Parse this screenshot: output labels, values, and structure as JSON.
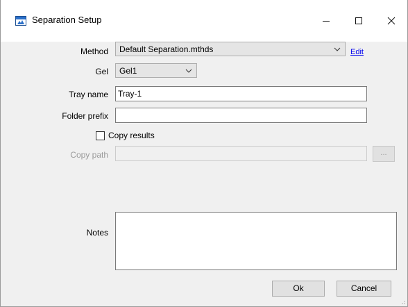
{
  "window": {
    "title": "Separation Setup",
    "icon": "app-icon"
  },
  "titlebar_buttons": {
    "minimize": "—",
    "maximize": "☐",
    "close": "✕"
  },
  "form": {
    "method_label": "Method",
    "method_value": "Default Separation.mthds",
    "edit_link": "Edit",
    "gel_label": "Gel",
    "gel_value": "Gel1",
    "tray_name_label": "Tray name",
    "tray_name_value": "Tray-1",
    "folder_prefix_label": "Folder prefix",
    "folder_prefix_value": "",
    "copy_results_label": "Copy results",
    "copy_results_checked": false,
    "copy_path_label": "Copy path",
    "copy_path_value": "",
    "browse_label": "...",
    "notes_label": "Notes",
    "notes_value": ""
  },
  "buttons": {
    "ok": "Ok",
    "cancel": "Cancel"
  },
  "colors": {
    "link": "#0000ee",
    "disabled_text": "#9a9a9a",
    "dialog_bg": "#f0f0f0",
    "titlebar_bg": "#ffffff"
  }
}
